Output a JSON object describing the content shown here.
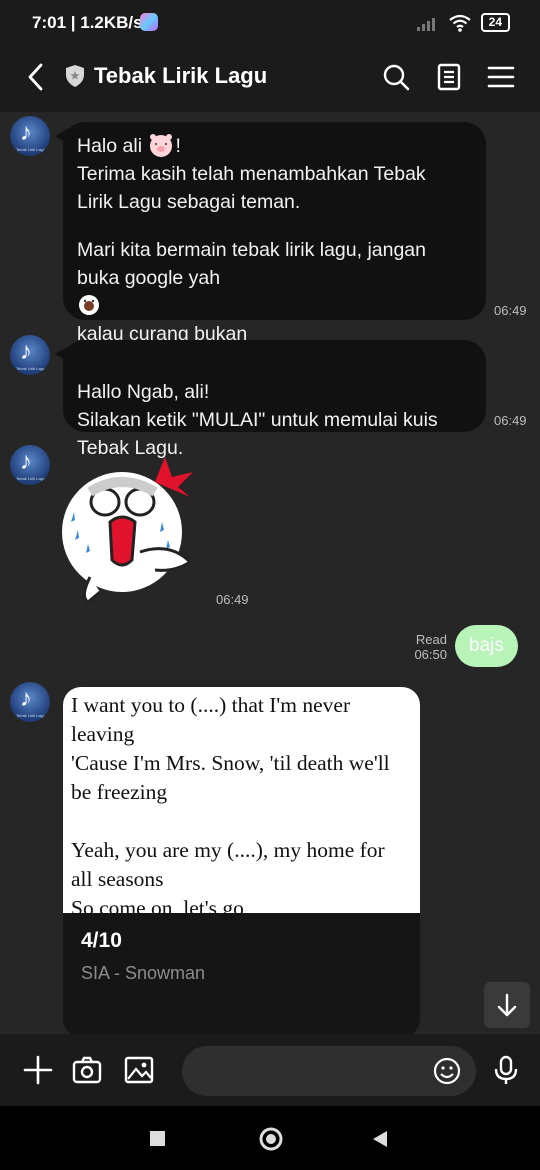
{
  "status_bar": {
    "time": "7:01",
    "speed": "1.2KB/s",
    "battery": "24"
  },
  "header": {
    "title": "Tebak Lirik Lagu"
  },
  "colors": {
    "bubble_received": "#111111",
    "bubble_sent": "#b8f3b8",
    "background": "#262626"
  },
  "messages": [
    {
      "greeting": "Halo ali",
      "lines": "Terima kasih telah menambahkan Tebak\nLirik Lagu sebagai teman.",
      "lines2_a": "Mari kita bermain tebak lirik lagu, jangan\nbuka google yah",
      "lines2_b": "kalau curang bukan\norang cerdas",
      "time": "06:49"
    },
    {
      "text": "Hallo Ngab, ali!\nSilakan ketik \"MULAI\" untuk memulai kuis\nTebak Lagu.",
      "time": "06:49"
    },
    {
      "sticker": "crying-face-sticker",
      "time": "06:49"
    }
  ],
  "sent": {
    "text": "bajs",
    "read_label": "Read",
    "time": "06:50"
  },
  "quiz_card": {
    "lyrics": "I want you to (....) that I'm never\nleaving\n'Cause I'm Mrs. Snow, 'til death we'll\nbe freezing\n\nYeah, you are my (....), my home for\nall seasons\nSo come on, let's go",
    "score": "4/10",
    "song": "SIA - Snowman"
  },
  "input": {
    "placeholder": ""
  }
}
